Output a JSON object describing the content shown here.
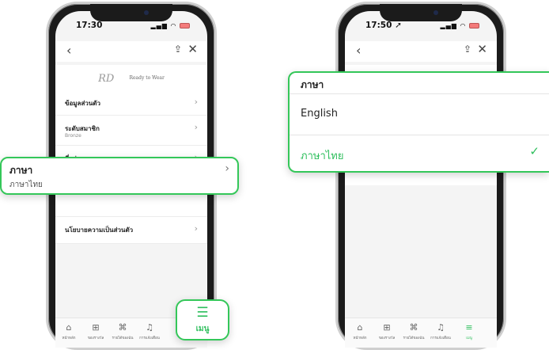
{
  "left_phone": {
    "time": "17:30",
    "brand_logo": "RD",
    "brand_text": "Ready to Wear",
    "menu": [
      {
        "label": "ข้อมูลส่วนตัว",
        "sub": ""
      },
      {
        "label": "ระดับสมาชิก",
        "sub": "Bronze"
      },
      {
        "label": "ที่อยู่",
        "sub": ""
      },
      {
        "label": "",
        "sub": ""
      },
      {
        "label": "นโยบายความเป็นส่วนตัว",
        "sub": ""
      }
    ],
    "language_callout": {
      "title": "ภาษา",
      "value": "ภาษาไทย"
    },
    "menu_button": {
      "label": "เมนู"
    }
  },
  "right_phone": {
    "time": "17:50",
    "dialog": {
      "title": "ภาษา",
      "options": [
        {
          "label": "English",
          "selected": false
        },
        {
          "label": "ภาษาไทย",
          "selected": true
        }
      ]
    }
  },
  "bottom_nav": [
    {
      "icon": "home-icon",
      "glyph": "⌂",
      "label": "หน้าหลัก"
    },
    {
      "icon": "gift-icon",
      "glyph": "🎁︎",
      "label": "ของรางวัล"
    },
    {
      "icon": "store-icon",
      "glyph": "⌘",
      "label": "รายได้ของฉัน"
    },
    {
      "icon": "bell-icon",
      "glyph": "♪",
      "label": "การแจ้งเตือน"
    },
    {
      "icon": "menu-icon",
      "glyph": "≡",
      "label": "เมนู"
    }
  ],
  "colors": {
    "accent": "#34c759",
    "accent_text": "#2fbf5d"
  }
}
